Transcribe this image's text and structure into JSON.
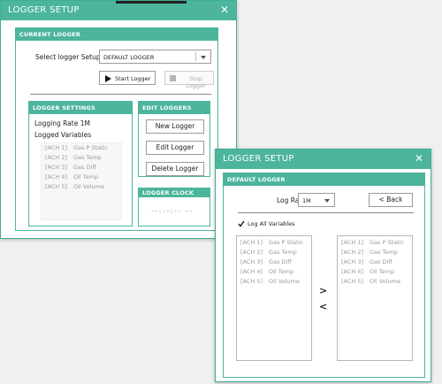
{
  "main_window": {
    "title": "LOGGER SETUP",
    "close_glyph": "✕",
    "current_logger": {
      "header": "CURRENT LOGGER",
      "select_label": "Select logger Setup",
      "selected_value": "DEFAULT LOGGER",
      "start_label": "Start Logger",
      "stop_label": "Stop Logger"
    },
    "logger_settings": {
      "header": "LOGGER SETTINGS",
      "rate_text": "Logging Rate 1M",
      "logged_vars_label": "Logged Variables",
      "variables": [
        {
          "code": "[ACH 1]",
          "name": "Gas P Static"
        },
        {
          "code": "[ACH 2]",
          "name": "Gas Temp"
        },
        {
          "code": "[ACH 3]",
          "name": "Gas Diff"
        },
        {
          "code": "[ACH 4]",
          "name": "Oil Temp"
        },
        {
          "code": "[ACH 5]",
          "name": "Oil Volume"
        }
      ]
    },
    "edit_loggers": {
      "header": "EDIT LOGGERS",
      "new_label": "New Logger",
      "edit_label": "Edit Logger",
      "delete_label": "Delete Logger"
    },
    "logger_clock": {
      "header": "LOGGER CLOCK",
      "time_text": "--:--:-- --"
    }
  },
  "second_window": {
    "title": "LOGGER SETUP",
    "close_glyph": "✕",
    "panel_header": "DEFAULT LOGGER",
    "log_rate_label": "Log Rate",
    "log_rate_value": "1M",
    "back_label": "< Back",
    "log_all_label": "Log All Variables",
    "log_all_checked": true,
    "left_list": [
      {
        "code": "[ACH 1]",
        "name": "Gas P Static"
      },
      {
        "code": "[ACH 2]",
        "name": "Gas Temp"
      },
      {
        "code": "[ACH 3]",
        "name": "Gas Diff"
      },
      {
        "code": "[ACH 4]",
        "name": "Oil Temp"
      },
      {
        "code": "[ACH 5]",
        "name": "Oil Volume"
      }
    ],
    "right_list": [
      {
        "code": "[ACH 1]",
        "name": "Gas P Static"
      },
      {
        "code": "[ACH 2]",
        "name": "Gas Temp"
      },
      {
        "code": "[ACH 3]",
        "name": "Gas Diff"
      },
      {
        "code": "[ACH 4]",
        "name": "Oil Temp"
      },
      {
        "code": "[ACH 5]",
        "name": "Oil Volume"
      }
    ],
    "move_right_glyph": ">",
    "move_left_glyph": "<"
  },
  "colors": {
    "accent": "#4cb59c",
    "background": "#f0f0f0"
  }
}
